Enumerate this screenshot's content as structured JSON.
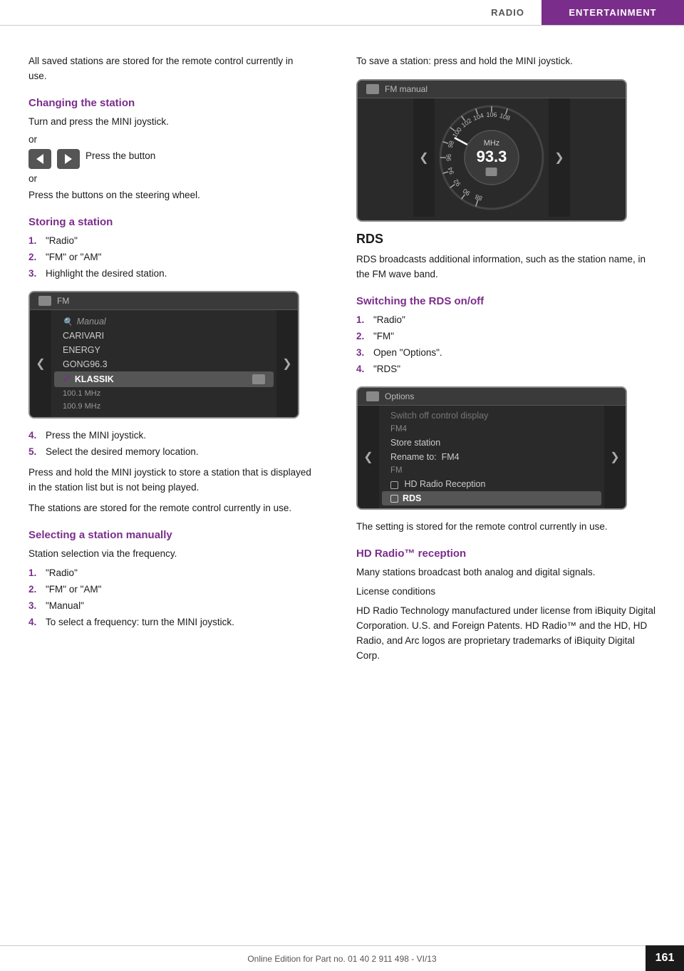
{
  "header": {
    "radio_label": "RADIO",
    "entertainment_label": "ENTERTAINMENT"
  },
  "left_col": {
    "intro_text": "All saved stations are stored for the remote control currently in use.",
    "changing_station_heading": "Changing the station",
    "changing_p1": "Turn and press the MINI joystick.",
    "or1": "or",
    "press_button_label": "Press the button",
    "or2": "or",
    "press_steering": "Press the buttons on the steering wheel.",
    "storing_heading": "Storing a station",
    "storing_steps": [
      {
        "num": "1.",
        "text": "\"Radio\""
      },
      {
        "num": "2.",
        "text": "\"FM\" or \"AM\""
      },
      {
        "num": "3.",
        "text": "Highlight the desired station."
      }
    ],
    "station_screen": {
      "header_label": "FM",
      "items": [
        {
          "type": "search",
          "label": "Manual"
        },
        {
          "type": "normal",
          "label": "CARIVARI"
        },
        {
          "type": "normal",
          "label": "ENERGY"
        },
        {
          "type": "normal",
          "label": "GONG96.3"
        },
        {
          "type": "highlighted",
          "label": "✓ KLASSIK"
        },
        {
          "type": "freq",
          "label": "100.1 MHz"
        },
        {
          "type": "freq",
          "label": "100.9 MHz"
        }
      ]
    },
    "storing_steps2": [
      {
        "num": "4.",
        "text": "Press the MINI joystick."
      },
      {
        "num": "5.",
        "text": "Select the desired memory location."
      }
    ],
    "storing_note1": "Press and hold the MINI joystick to store a station that is displayed in the station list but is not being played.",
    "storing_note2": "The stations are stored for the remote control currently in use.",
    "selecting_heading": "Selecting a station manually",
    "selecting_intro": "Station selection via the frequency.",
    "selecting_steps": [
      {
        "num": "1.",
        "text": "\"Radio\""
      },
      {
        "num": "2.",
        "text": "\"FM\" or \"AM\""
      },
      {
        "num": "3.",
        "text": "\"Manual\""
      },
      {
        "num": "4.",
        "text": "To select a frequency: turn the MINI joystick."
      }
    ]
  },
  "right_col": {
    "save_station_text": "To save a station: press and hold the MINI joystick.",
    "dial_screen": {
      "header_label": "FM manual",
      "freq_mhz": "MHz",
      "freq_value": "93.3",
      "dial_labels": [
        "88",
        "90",
        "92",
        "94",
        "96",
        "98",
        "100",
        "102",
        "104",
        "106",
        "108"
      ]
    },
    "rds_heading": "RDS",
    "rds_text": "RDS broadcasts additional information, such as the station name, in the FM wave band.",
    "switching_heading": "Switching the RDS on/off",
    "switching_steps": [
      {
        "num": "1.",
        "text": "\"Radio\""
      },
      {
        "num": "2.",
        "text": "\"FM\""
      },
      {
        "num": "3.",
        "text": "Open \"Options\"."
      },
      {
        "num": "4.",
        "text": "\"RDS\""
      }
    ],
    "options_screen": {
      "header_label": "Options",
      "items": [
        {
          "type": "dimmed",
          "label": "Switch off control display"
        },
        {
          "type": "group",
          "label": "FM4"
        },
        {
          "type": "normal",
          "label": "Store station"
        },
        {
          "type": "normal",
          "label": "Rename to:  FM4"
        },
        {
          "type": "group",
          "label": "FM"
        },
        {
          "type": "normal",
          "label": "☐  HD Radio Reception"
        },
        {
          "type": "highlighted",
          "label": "☑  RDS"
        }
      ]
    },
    "rds_setting_note": "The setting is stored for the remote control currently in use.",
    "hd_radio_heading": "HD Radio™ reception",
    "hd_p1": "Many stations broadcast both analog and digital signals.",
    "hd_p2": "License conditions",
    "hd_p3": "HD Radio Technology manufactured under license from iBiquity Digital Corporation. U.S. and Foreign Patents. HD Radio™ and the HD, HD Radio, and Arc logos are proprietary trademarks of iBiquity Digital Corp."
  },
  "footer": {
    "text": "Online Edition for Part no. 01 40 2 911 498 - VI/13",
    "page_number": "161"
  }
}
